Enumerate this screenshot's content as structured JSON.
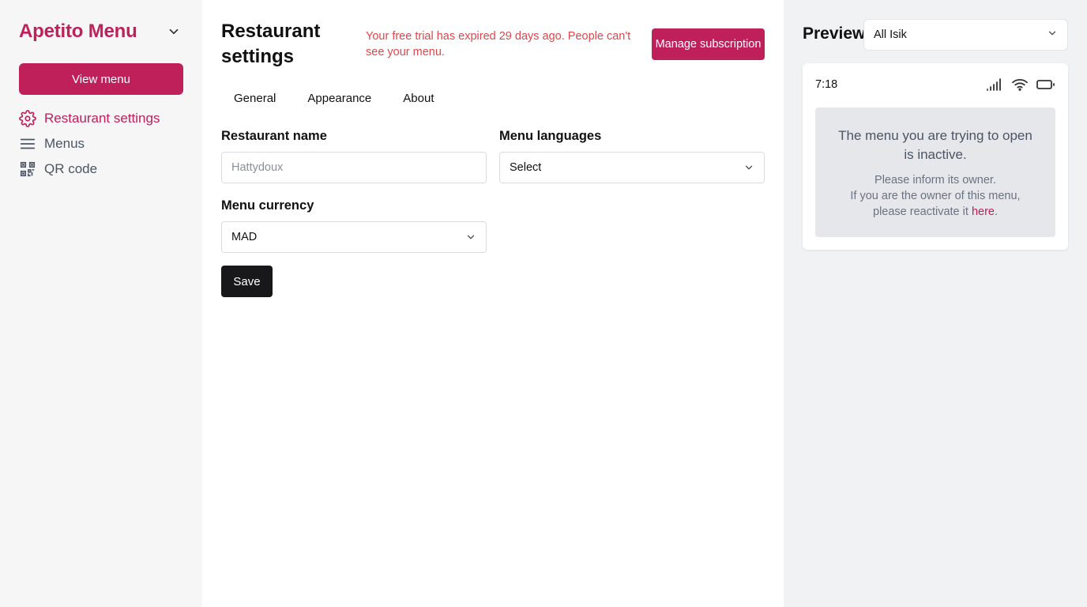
{
  "sidebar": {
    "brand": "Apetito Menu",
    "view_menu_label": "View menu",
    "items": [
      {
        "label": "Restaurant settings",
        "icon": "gear-icon",
        "active": true
      },
      {
        "label": "Menus",
        "icon": "menu-lines-icon",
        "active": false
      },
      {
        "label": "QR code",
        "icon": "qr-code-icon",
        "active": false
      }
    ]
  },
  "header": {
    "title": "Restaurant settings",
    "trial_message": "Your free trial has expired 29 days ago. People can't see your menu.",
    "manage_label": "Manage subscription"
  },
  "tabs": [
    "General",
    "Appearance",
    "About"
  ],
  "form": {
    "name_label": "Restaurant name",
    "name_placeholder": "Hattydoux",
    "name_value": "",
    "languages_label": "Menu languages",
    "languages_value": "Select",
    "currency_label": "Menu currency",
    "currency_value": "MAD",
    "save_label": "Save"
  },
  "preview": {
    "title": "Preview",
    "selected_menu": "All Isik",
    "status_time": "7:18",
    "notice_heading": "The menu you are trying to open is inactive.",
    "notice_line1": "Please inform its owner.",
    "notice_line2": "If you are the owner of this menu,",
    "notice_line3_prefix": "please reactivate it ",
    "notice_link": "here",
    "notice_line3_suffix": "."
  },
  "colors": {
    "brand": "#c0205a",
    "warning": "#e0464b",
    "dark_button": "#18181b"
  }
}
